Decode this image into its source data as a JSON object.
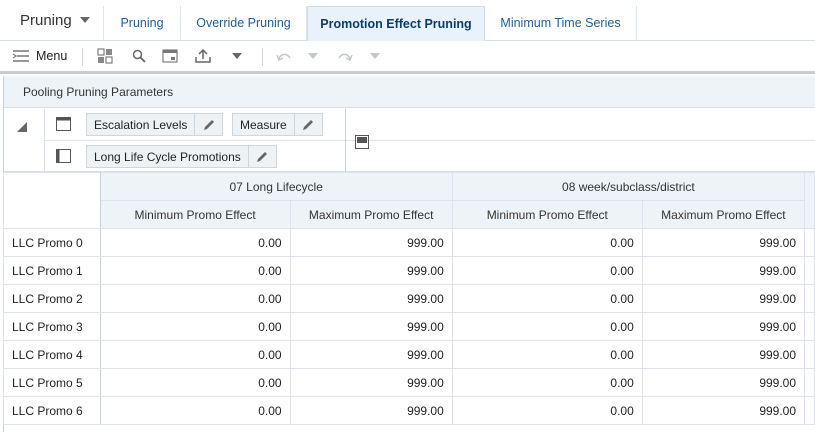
{
  "app_selector": {
    "label": "Pruning"
  },
  "tabs": [
    {
      "label": "Pruning",
      "active": false
    },
    {
      "label": "Override Pruning",
      "active": false
    },
    {
      "label": "Promotion Effect Pruning",
      "active": true
    },
    {
      "label": "Minimum Time Series",
      "active": false
    }
  ],
  "toolbar": {
    "menu_label": "Menu"
  },
  "panel": {
    "title": "Pooling Pruning Parameters",
    "pivot": {
      "row_chips": [
        "Escalation Levels",
        "Measure"
      ],
      "column_chips": [
        "Long Life Cycle Promotions"
      ]
    }
  },
  "grid": {
    "groups": [
      "07 Long Lifecycle",
      "08 week/subclass/district"
    ],
    "columns": [
      "Minimum Promo Effect",
      "Maximum Promo Effect",
      "Minimum Promo Effect",
      "Maximum Promo Effect"
    ],
    "rows": [
      {
        "label": "LLC Promo 0",
        "values": [
          "0.00",
          "999.00",
          "0.00",
          "999.00"
        ]
      },
      {
        "label": "LLC Promo 1",
        "values": [
          "0.00",
          "999.00",
          "0.00",
          "999.00"
        ]
      },
      {
        "label": "LLC Promo 2",
        "values": [
          "0.00",
          "999.00",
          "0.00",
          "999.00"
        ]
      },
      {
        "label": "LLC Promo 3",
        "values": [
          "0.00",
          "999.00",
          "0.00",
          "999.00"
        ]
      },
      {
        "label": "LLC Promo 4",
        "values": [
          "0.00",
          "999.00",
          "0.00",
          "999.00"
        ]
      },
      {
        "label": "LLC Promo 5",
        "values": [
          "0.00",
          "999.00",
          "0.00",
          "999.00"
        ]
      },
      {
        "label": "LLC Promo 6",
        "values": [
          "0.00",
          "999.00",
          "0.00",
          "999.00"
        ]
      }
    ]
  }
}
